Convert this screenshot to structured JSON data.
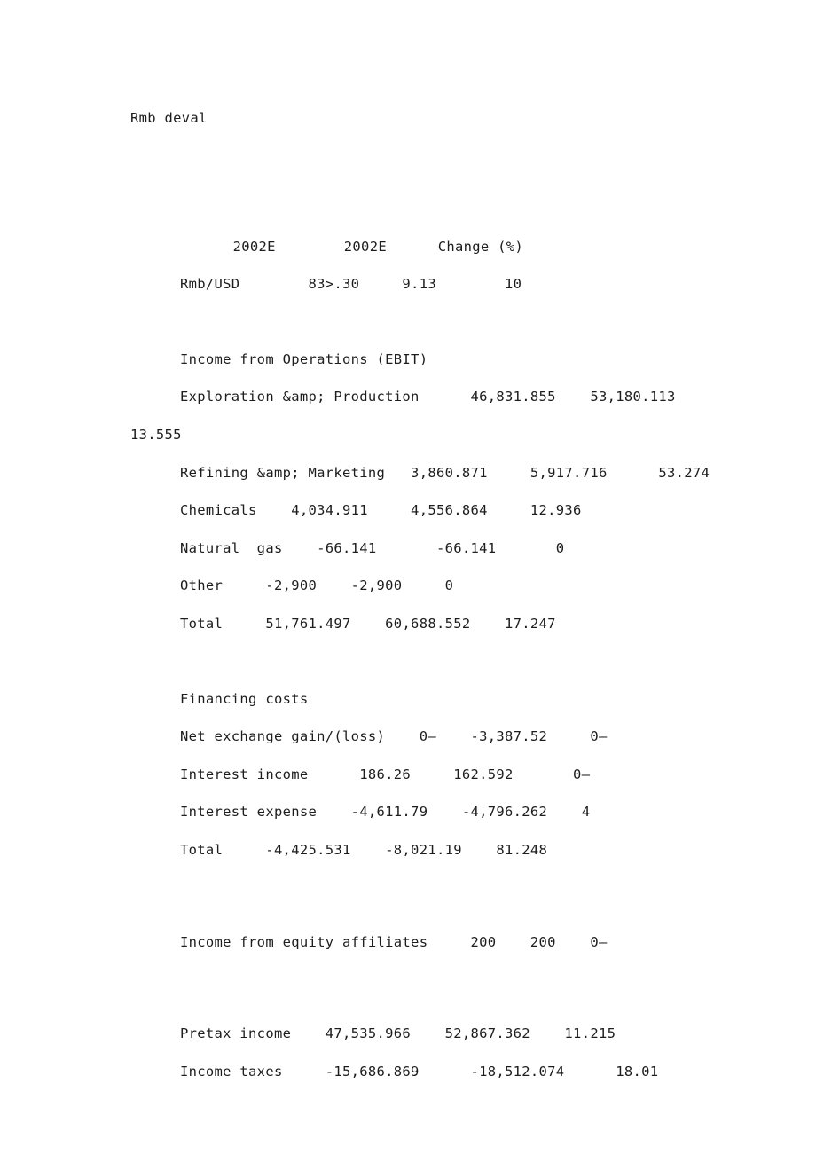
{
  "document": {
    "heading": "Rmb deval",
    "table_header": "            2002E        2002E      Change (%)",
    "fx_row": "Rmb/USD        83>.30     9.13        10",
    "sections": [
      {
        "title": "Income from Operations (EBIT)",
        "rows": [
          "Exploration &amp; Production      46,831.855    53,180.113",
          "13.555",
          "Refining &amp; Marketing   3,860.871     5,917.716      53.274",
          "Chemicals    4,034.911     4,556.864     12.936",
          "Natural  gas    -66.141       -66.141       0",
          "Other     -2,900    -2,900     0",
          "Total     51,761.497    60,688.552    17.247"
        ]
      },
      {
        "title": "Financing costs",
        "rows": [
          "Net exchange gain/(loss)    0—    -3,387.52     0—",
          "Interest income      186.26     162.592       0—",
          "Interest expense    -4,611.79    -4,796.262    4",
          "Total     -4,425.531    -8,021.19    81.248"
        ]
      },
      {
        "title": "",
        "rows": [
          "Income from equity affiliates     200    200    0—"
        ]
      },
      {
        "title": "",
        "rows": [
          "Pretax income    47,535.966    52,867.362    11.215",
          "Income taxes     -15,686.869      -18,512.074      18.01"
        ]
      }
    ]
  }
}
